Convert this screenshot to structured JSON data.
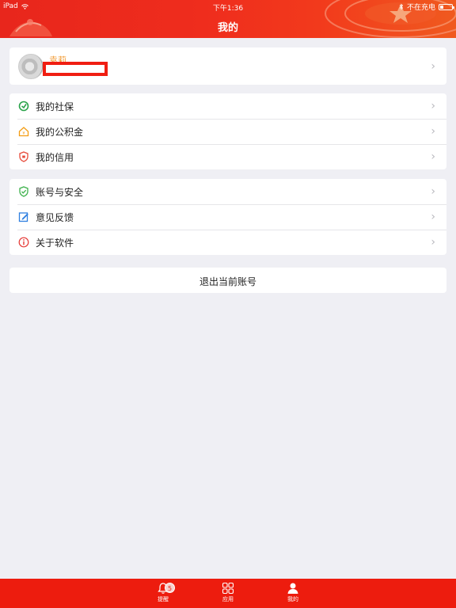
{
  "status_bar": {
    "device": "iPad",
    "time": "下午1:36",
    "charging": "不在充电"
  },
  "nav": {
    "title": "我的"
  },
  "profile": {
    "name": "袁莉"
  },
  "menu_group_1": [
    {
      "label": "我的社保",
      "icon": "social-security-icon",
      "color": "#2aa34a"
    },
    {
      "label": "我的公积金",
      "icon": "housing-fund-icon",
      "color": "#f39c12"
    },
    {
      "label": "我的信用",
      "icon": "credit-shield-icon",
      "color": "#e74c3c"
    }
  ],
  "menu_group_2": [
    {
      "label": "账号与安全",
      "icon": "shield-check-icon",
      "color": "#3db14b"
    },
    {
      "label": "意见反馈",
      "icon": "edit-icon",
      "color": "#2f7fe0"
    },
    {
      "label": "关于软件",
      "icon": "info-icon",
      "color": "#e53935"
    }
  ],
  "logout": {
    "label": "退出当前账号"
  },
  "tabbar": {
    "color": "#ed1c0e",
    "tabs": [
      {
        "label": "提醒",
        "icon": "bell-icon",
        "badge": "5"
      },
      {
        "label": "应用",
        "icon": "apps-grid-icon"
      },
      {
        "label": "我的",
        "icon": "person-icon"
      }
    ]
  },
  "colors": {
    "header": "#ef2d1d",
    "accent_name": "#f19a32"
  }
}
